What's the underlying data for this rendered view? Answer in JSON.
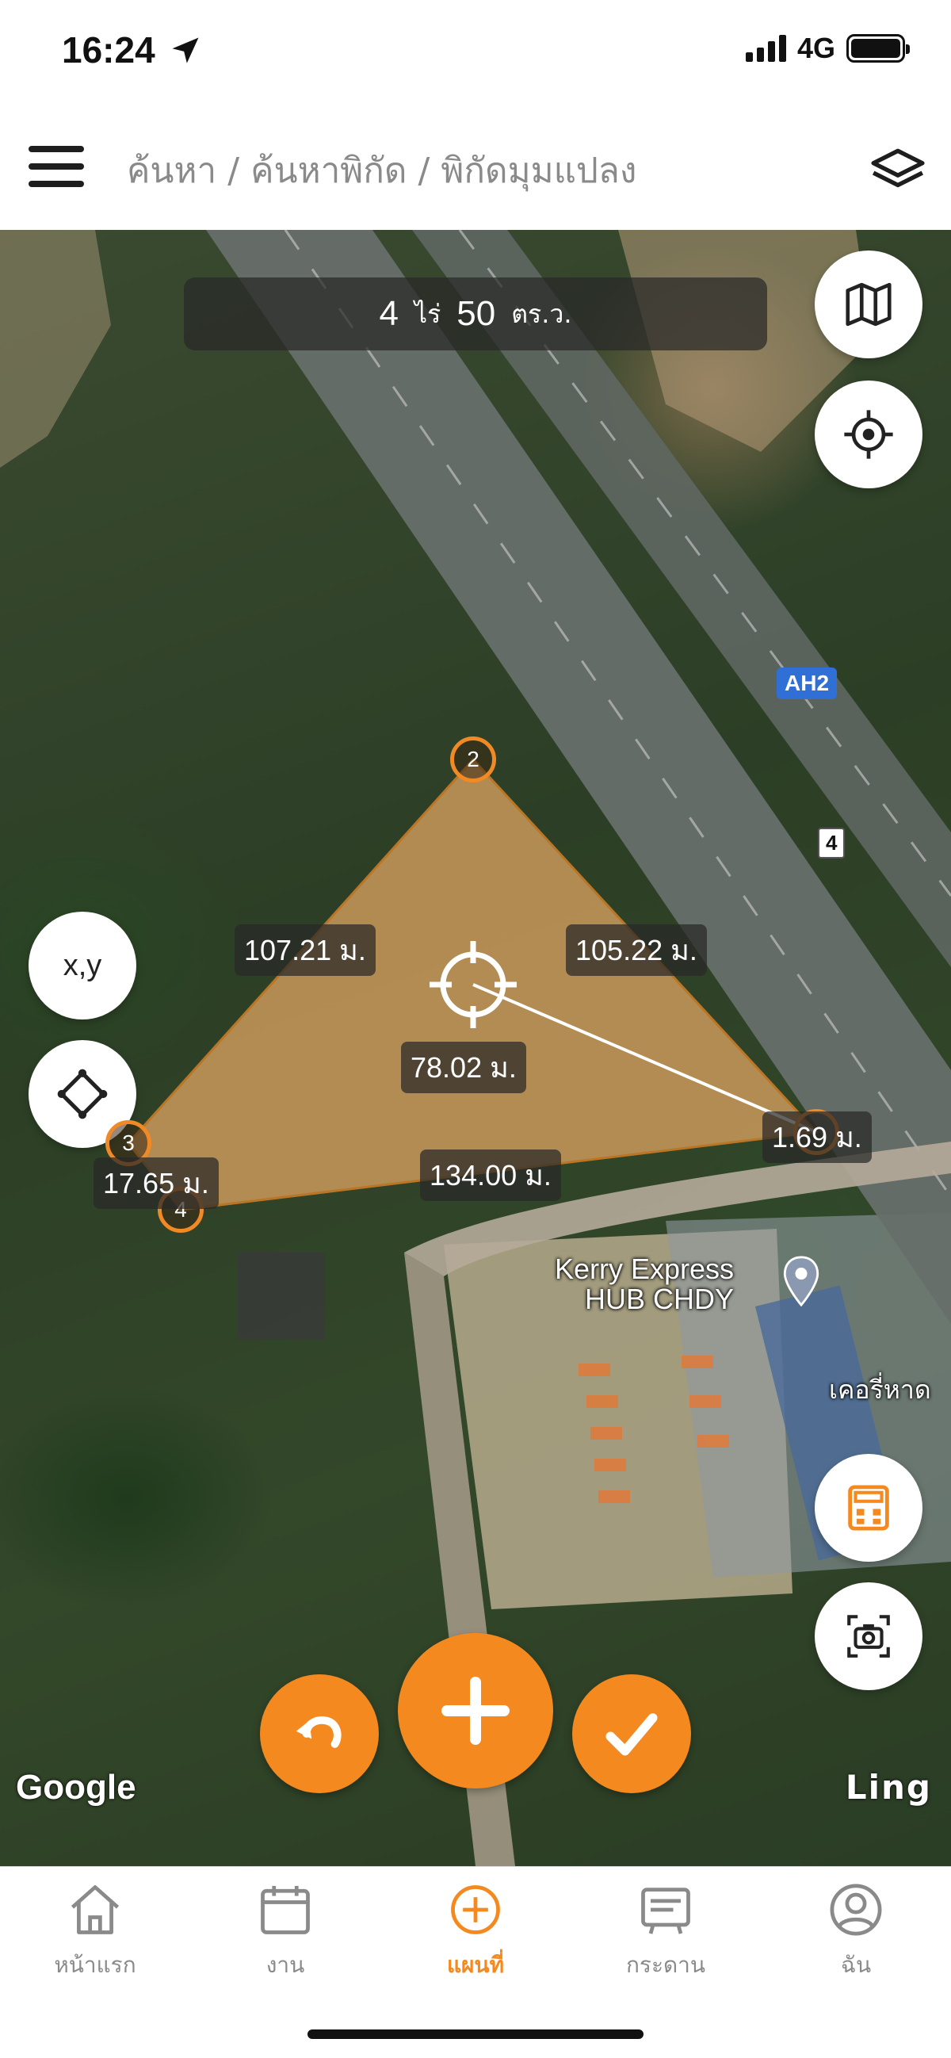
{
  "status_bar": {
    "time": "16:24",
    "network": "4G"
  },
  "header": {
    "breadcrumb": [
      "ค้นหา",
      "ค้นหาพิกัด",
      "พิกัดมุมแปลง"
    ],
    "separator": "/"
  },
  "area": {
    "rai_value": "4",
    "rai_unit": "ไร่",
    "wa_value": "50",
    "wa_unit": "ตร.ว."
  },
  "map_controls": {
    "xy_label": "x,y"
  },
  "road_labels": {
    "ah2": "AH2",
    "route4": "4"
  },
  "measurements": {
    "side_1_2": "107.21 ม.",
    "side_2_p": "105.22 ม.",
    "center_line": "78.02 ม.",
    "side_p_4": "134.00 ม.",
    "side_3_4": "17.65 ม.",
    "side_p_short": "1.69 ม."
  },
  "vertices": [
    "2",
    "3",
    "4"
  ],
  "poi": {
    "name_line1": "Kerry Express",
    "name_line2": "HUB CHDY",
    "thai_label": "เคอรี่หาด"
  },
  "map_attribution": {
    "google": "Google",
    "ling": "Ling"
  },
  "bottom_nav": {
    "items": [
      {
        "label": "หน้าแรก",
        "icon": "home-icon"
      },
      {
        "label": "งาน",
        "icon": "calendar-icon"
      },
      {
        "label": "แผนที่",
        "icon": "plus-circle-icon"
      },
      {
        "label": "กระดาน",
        "icon": "board-icon"
      },
      {
        "label": "ฉัน",
        "icon": "user-icon"
      }
    ],
    "active_index": 2
  },
  "colors": {
    "accent": "#f4891f",
    "polygon_fill": "#e6a964",
    "inactive": "#8a8a8a"
  }
}
